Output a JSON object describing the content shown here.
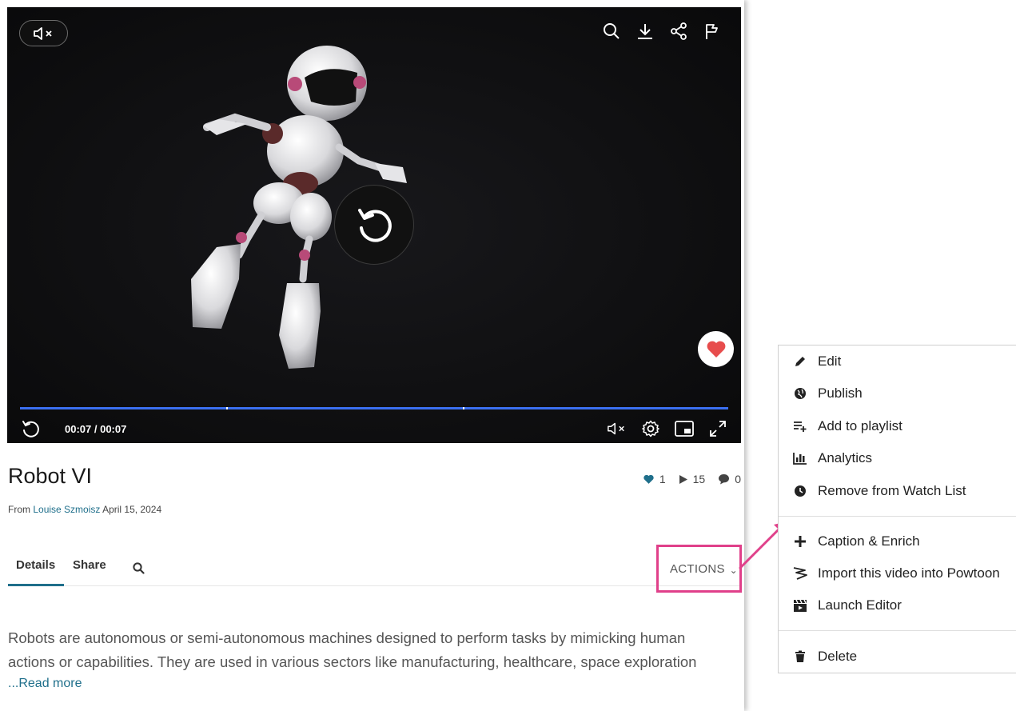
{
  "player": {
    "time_display": "00:07 / 00:07"
  },
  "media": {
    "title": "Robot VI",
    "from_label": "From",
    "author": "Louise Szmoisz",
    "date": "April 15, 2024",
    "likes": "1",
    "plays": "15",
    "comments": "0"
  },
  "tabs": {
    "details": "Details",
    "share": "Share"
  },
  "actions": {
    "label": "ACTIONS"
  },
  "description": {
    "text": "Robots are autonomous or semi-autonomous machines designed to perform tasks by mimicking human actions or capabilities. They are used in various sectors like manufacturing, healthcare, space exploration",
    "read_more": "...Read more"
  },
  "menu": {
    "items": [
      {
        "label": "Edit",
        "icon": "pencil-icon"
      },
      {
        "label": "Publish",
        "icon": "globe-icon"
      },
      {
        "label": "Add to playlist",
        "icon": "playlist-add-icon"
      },
      {
        "label": "Analytics",
        "icon": "bar-chart-icon"
      },
      {
        "label": "Remove from Watch List",
        "icon": "clock-icon"
      },
      {
        "label": "Caption & Enrich",
        "icon": "plus-icon"
      },
      {
        "label": "Import this video into Powtoon",
        "icon": "powtoon-icon"
      },
      {
        "label": "Launch Editor",
        "icon": "clapperboard-icon"
      },
      {
        "label": "Delete",
        "icon": "trash-icon"
      }
    ]
  },
  "colors": {
    "accent": "#1f6f8b",
    "highlight": "#e0408a",
    "progress": "#3b6ff0",
    "like": "#e74c4c"
  }
}
